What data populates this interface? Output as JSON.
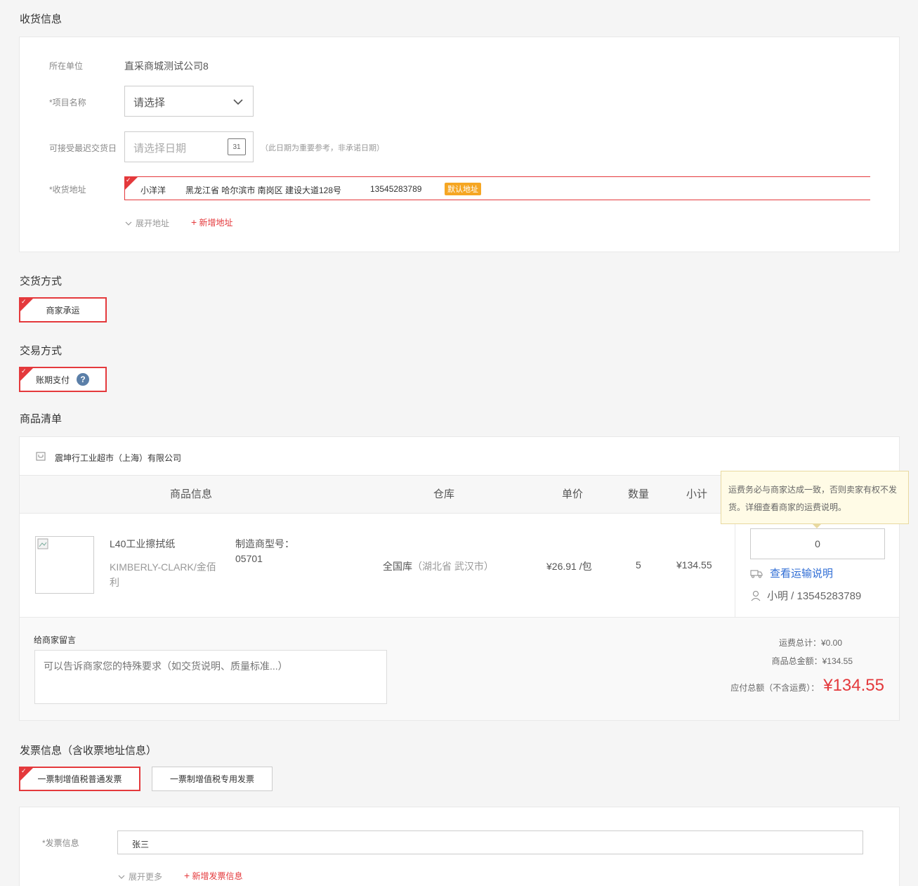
{
  "receiving": {
    "title": "收货信息",
    "unit_label": "所在单位",
    "unit_value": "直采商城测试公司8",
    "project_label": "*项目名称",
    "project_placeholder": "请选择",
    "date_label": "可接受最迟交货日",
    "date_placeholder": "请选择日期",
    "date_icon_text": "31",
    "date_note": "（此日期为重要参考，非承诺日期）",
    "address_label": "*收货地址",
    "address": {
      "name": "小洋洋",
      "detail": "黑龙江省 哈尔滨市 南岗区 建设大道128号",
      "phone": "13545283789",
      "badge": "默认地址"
    },
    "expand_label": "展开地址",
    "add_label": "新增地址"
  },
  "delivery": {
    "title": "交货方式",
    "option": "商家承运"
  },
  "trade": {
    "title": "交易方式",
    "option": "账期支付"
  },
  "goods": {
    "title": "商品清单",
    "shop_name": "震坤行工业超市（上海）有限公司",
    "headers": [
      "商品信息",
      "仓库",
      "单价",
      "数量",
      "小计"
    ],
    "item": {
      "name": "L40工业擦拭纸",
      "brand": "KIMBERLY-CLARK/金佰利",
      "model_label": "制造商型号：",
      "model_value": "05701",
      "warehouse": "全国库",
      "warehouse_location": "（湖北省 武汉市）",
      "price": "¥26.91 /包",
      "qty": "5",
      "subtotal": "¥134.55"
    },
    "tooltip": "运费务必与商家达成一致，否则卖家有权不发货。详细查看商家的运费说明。",
    "freight_value": "0",
    "freight_link": "查看运输说明",
    "contact": "小明 / 13545283789",
    "message_label": "给商家留言",
    "message_placeholder": "可以告诉商家您的特殊要求（如交货说明、质量标准...）",
    "freight_total_label": "运费总计：",
    "freight_total_value": "¥0.00",
    "goods_total_label": "商品总金额：",
    "goods_total_value": "¥134.55",
    "payable_label": "应付总额（不含运费）：",
    "payable_value": "¥134.55"
  },
  "invoice": {
    "title": "发票信息（含收票地址信息）",
    "option_normal": "一票制增值税普通发票",
    "option_special": "一票制增值税专用发票",
    "info_label": "*发票信息",
    "info_value": "张三",
    "expand_label": "展开更多",
    "add_label": "新增发票信息"
  },
  "colors": {
    "accent": "#e4393c",
    "link": "#2f6dd5",
    "badge": "#f5a623",
    "tooltip_bg": "#fffbe6"
  }
}
